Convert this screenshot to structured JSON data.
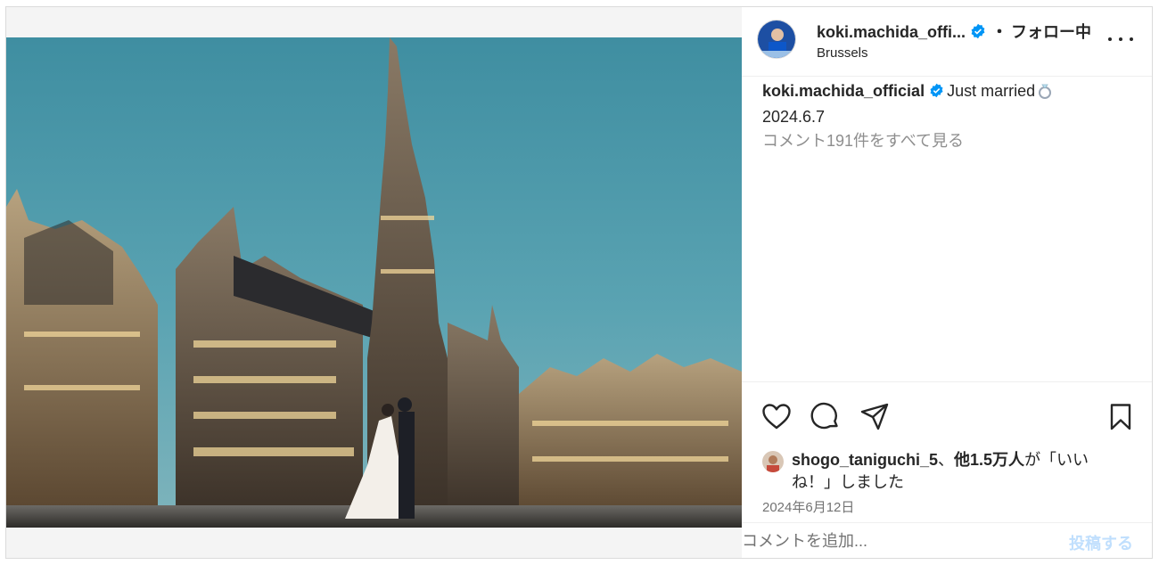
{
  "post": {
    "username_short": "koki.machida_offi...",
    "separator": "・",
    "follow_status": "フォロー中",
    "location": "Brussels",
    "caption": {
      "username": "koki.machida_official",
      "text": "Just married",
      "date": "2024.6.7"
    },
    "view_all_comments": "コメント191件をすべて見る",
    "likes": {
      "user": "shogo_taniguchi_5",
      "connector": "、",
      "others": "他1.5万人",
      "suffix": "が「いいね！」しました"
    },
    "post_date": "2024年6月12日",
    "comment_placeholder": "コメントを追加...",
    "post_button": "投稿する"
  },
  "icons": {
    "verified": "verified-badge-icon",
    "ring": "ring-icon",
    "more": "more-options-icon",
    "like": "heart-icon",
    "comment": "comment-bubble-icon",
    "share": "paper-plane-icon",
    "save": "bookmark-icon"
  },
  "colors": {
    "verified_blue": "#0095f6",
    "post_button_disabled": "#c0dffd",
    "muted_text": "#8e8e8e"
  }
}
